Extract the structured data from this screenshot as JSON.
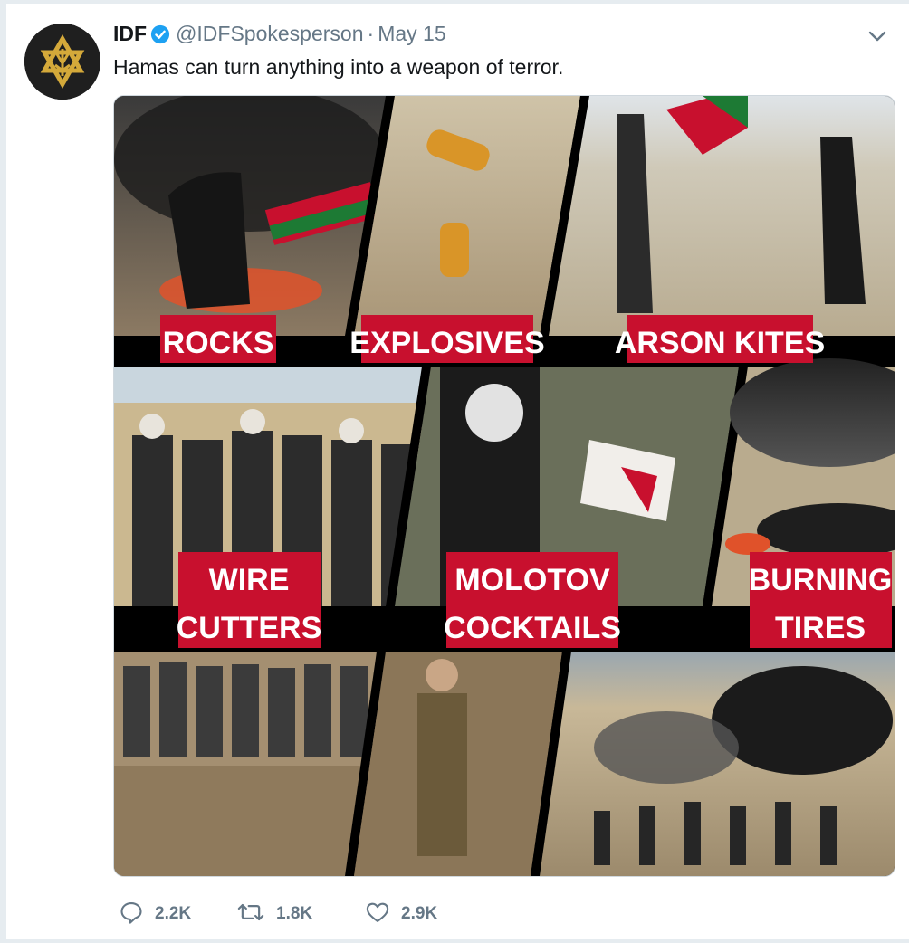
{
  "tweet": {
    "author_name": "IDF",
    "author_handle": "@IDFSpokesperson",
    "separator": "·",
    "date": "May 15",
    "text": "Hamas can turn anything into a weapon of terror."
  },
  "media": {
    "panels": [
      {
        "line1": "ROCKS",
        "line2": ""
      },
      {
        "line1": "EXPLOSIVES",
        "line2": ""
      },
      {
        "line1": "ARSON KITES",
        "line2": ""
      },
      {
        "line1": "WIRE",
        "line2": "CUTTERS"
      },
      {
        "line1": "MOLOTOV",
        "line2": "COCKTAILS"
      },
      {
        "line1": "BURNING",
        "line2": "TIRES"
      }
    ]
  },
  "actions": {
    "replies": "2.2K",
    "retweets": "1.8K",
    "likes": "2.9K"
  },
  "colors": {
    "caption_red": "#c8102e",
    "muted": "#657786",
    "verified_blue": "#1da1f2"
  },
  "icons": {
    "avatar": "idf-emblem-icon",
    "verified": "verified-badge-icon",
    "menu": "chevron-down-icon",
    "reply": "reply-icon",
    "retweet": "retweet-icon",
    "like": "heart-icon"
  }
}
